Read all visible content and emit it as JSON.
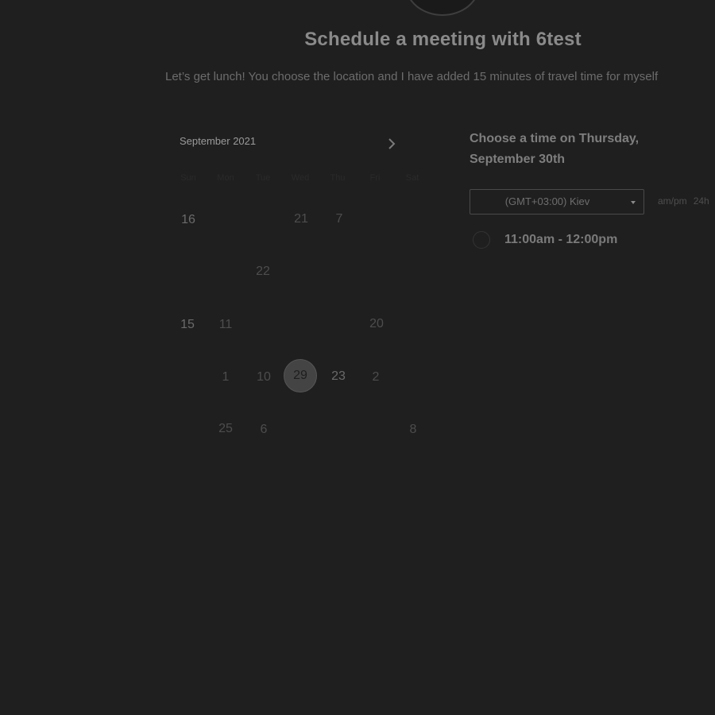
{
  "header": {
    "title": "Schedule a meeting with 6test",
    "description": "Let’s get lunch! You choose the location and I have added 15 minutes of travel time for myself"
  },
  "calendar": {
    "month_label": "September 2021",
    "next_icon": "chevron-right-icon",
    "weekdays": [
      "Sun",
      "Mon",
      "Tue",
      "Wed",
      "Thu",
      "Fri",
      "Sat"
    ],
    "days": [
      {
        "label": "16",
        "state": "available"
      },
      {
        "label": "21",
        "state": "muted"
      },
      {
        "label": "7",
        "state": "muted"
      },
      {
        "label": "22",
        "state": "muted"
      },
      {
        "label": "15",
        "state": "available"
      },
      {
        "label": "11",
        "state": "muted"
      },
      {
        "label": "20",
        "state": "muted"
      },
      {
        "label": "1",
        "state": "muted"
      },
      {
        "label": "10",
        "state": "muted"
      },
      {
        "label": "23",
        "state": "available"
      },
      {
        "label": "2",
        "state": "muted"
      },
      {
        "label": "25",
        "state": "muted"
      },
      {
        "label": "6",
        "state": "muted"
      },
      {
        "label": "8",
        "state": "muted"
      }
    ],
    "selected_day": "29"
  },
  "times": {
    "heading": "Choose a time on Thursday, September 30th",
    "timezone": "(GMT+03:00) Kiev",
    "format_ampm": "am/pm",
    "format_24h": "24h",
    "slot_label": "11:00am - 12:00pm"
  },
  "colors": {
    "background": "#1f1f1f",
    "title": "#8a8a8a",
    "selected_day": "#444444"
  }
}
